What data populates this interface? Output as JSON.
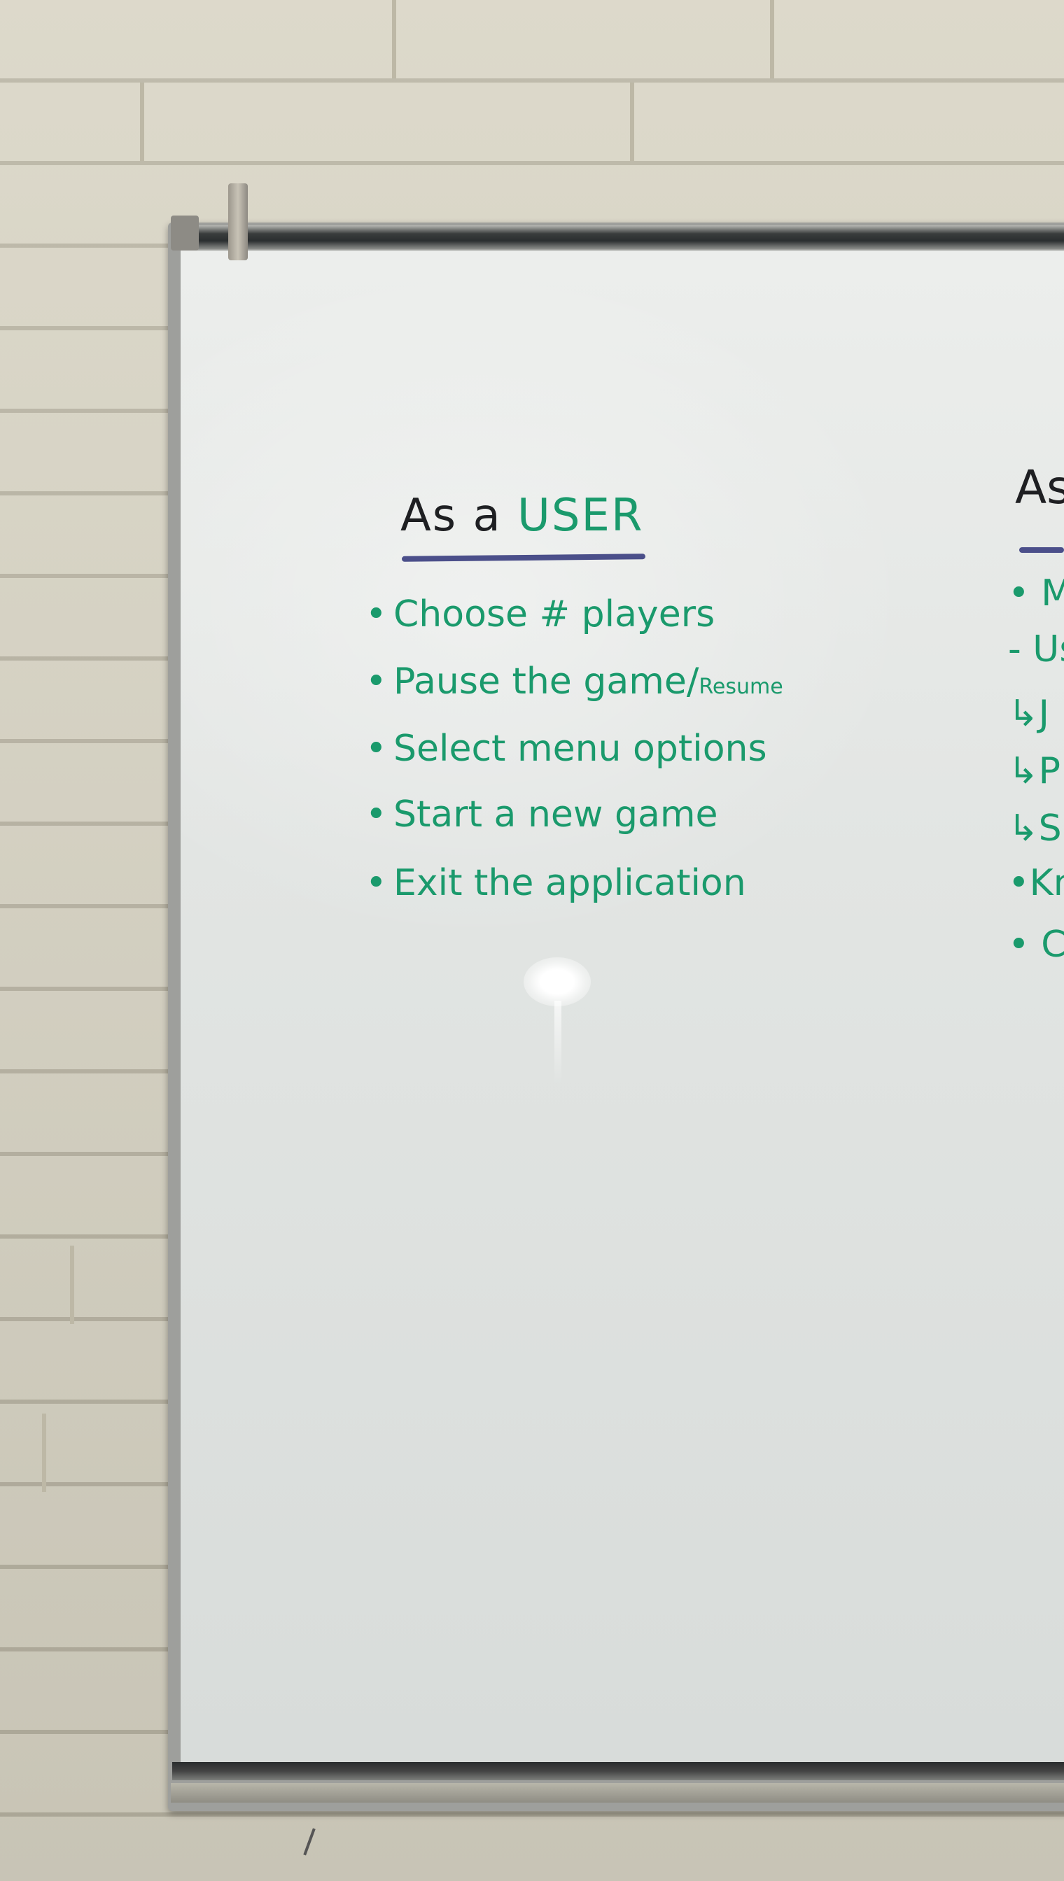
{
  "board": {
    "left_column": {
      "heading_prefix": "As a",
      "heading_highlight": "USER",
      "items": [
        {
          "bullet": "•",
          "text": "Choose # players",
          "extra": ""
        },
        {
          "bullet": "•",
          "text": "Pause the game/",
          "extra": "Resume"
        },
        {
          "bullet": "•",
          "text": "Select menu options",
          "extra": ""
        },
        {
          "bullet": "•",
          "text": "Start a new game",
          "extra": ""
        },
        {
          "bullet": "•",
          "text": "Exit the application",
          "extra": ""
        }
      ]
    },
    "right_column_partial": {
      "heading": "As",
      "items": [
        "• Me",
        "- Us",
        "↳J",
        "↳P",
        "↳S",
        "•Kn",
        "• C"
      ]
    }
  },
  "colors": {
    "green_marker": "#1a9a6c",
    "black_marker": "#1e1f22",
    "blue_underline": "#4b4f8a"
  }
}
